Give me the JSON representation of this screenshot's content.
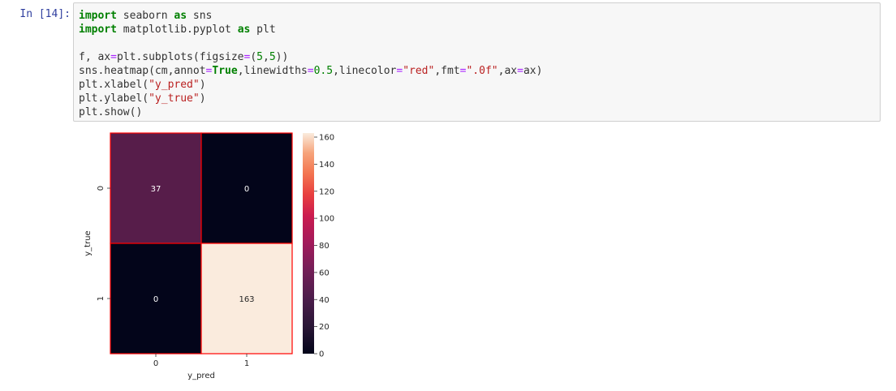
{
  "cell": {
    "prompt": "In [14]:",
    "code_lines": [
      [
        {
          "t": "import",
          "c": "kw"
        },
        {
          "t": " seaborn ",
          "c": ""
        },
        {
          "t": "as",
          "c": "kw"
        },
        {
          "t": " sns",
          "c": ""
        }
      ],
      [
        {
          "t": "import",
          "c": "kw"
        },
        {
          "t": " matplotlib.pyplot ",
          "c": ""
        },
        {
          "t": "as",
          "c": "kw"
        },
        {
          "t": " plt",
          "c": ""
        }
      ],
      [],
      [
        {
          "t": "f, ax",
          "c": ""
        },
        {
          "t": "=",
          "c": "op"
        },
        {
          "t": "plt.subplots(figsize",
          "c": ""
        },
        {
          "t": "=",
          "c": "op"
        },
        {
          "t": "(",
          "c": ""
        },
        {
          "t": "5",
          "c": "num"
        },
        {
          "t": ",",
          "c": ""
        },
        {
          "t": "5",
          "c": "num"
        },
        {
          "t": "))",
          "c": ""
        }
      ],
      [
        {
          "t": "sns.heatmap(cm,annot",
          "c": ""
        },
        {
          "t": "=",
          "c": "op"
        },
        {
          "t": "True",
          "c": "kwconst"
        },
        {
          "t": ",linewidths",
          "c": ""
        },
        {
          "t": "=",
          "c": "op"
        },
        {
          "t": "0.5",
          "c": "num"
        },
        {
          "t": ",linecolor",
          "c": ""
        },
        {
          "t": "=",
          "c": "op"
        },
        {
          "t": "\"red\"",
          "c": "str"
        },
        {
          "t": ",fmt",
          "c": ""
        },
        {
          "t": "=",
          "c": "op"
        },
        {
          "t": "\".0f\"",
          "c": "str"
        },
        {
          "t": ",ax",
          "c": ""
        },
        {
          "t": "=",
          "c": "op"
        },
        {
          "t": "ax)",
          "c": ""
        }
      ],
      [
        {
          "t": "plt.xlabel(",
          "c": ""
        },
        {
          "t": "\"y_pred\"",
          "c": "str"
        },
        {
          "t": ")",
          "c": ""
        }
      ],
      [
        {
          "t": "plt.ylabel(",
          "c": ""
        },
        {
          "t": "\"y_true\"",
          "c": "str"
        },
        {
          "t": ")",
          "c": ""
        }
      ],
      [
        {
          "t": "plt.show()",
          "c": ""
        }
      ]
    ]
  },
  "colors": {
    "prompt": "#303f9f",
    "grid_line": "#ff0000"
  },
  "chart_data": {
    "type": "heatmap",
    "x_categories": [
      "0",
      "1"
    ],
    "y_categories": [
      "0",
      "1"
    ],
    "values": [
      [
        37,
        0
      ],
      [
        0,
        163
      ]
    ],
    "annotations": [
      "37",
      "0",
      "0",
      "163"
    ],
    "xlabel": "y_pred",
    "ylabel": "y_true",
    "colormap": "rocket",
    "vmin": 0,
    "vmax": 163,
    "colorbar_ticks": [
      "0",
      "20",
      "40",
      "60",
      "80",
      "100",
      "120",
      "140",
      "160"
    ],
    "colorbar_tick_values": [
      0,
      20,
      40,
      60,
      80,
      100,
      120,
      140,
      160
    ],
    "cell_colors": [
      [
        "#571d4a",
        "#03051a"
      ],
      [
        "#03051a",
        "#faebdd"
      ]
    ],
    "annotation_colors": [
      [
        "#ffffff",
        "#ffffff"
      ],
      [
        "#ffffff",
        "#262626"
      ]
    ]
  }
}
